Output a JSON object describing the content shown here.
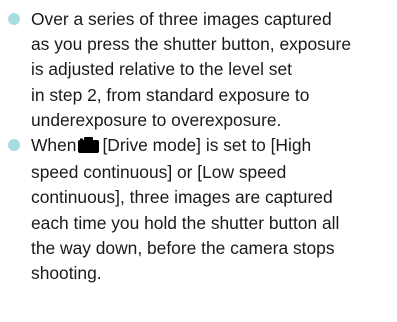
{
  "bullets": [
    {
      "lines": [
        "Over a series of three images captured",
        "as you press the shutter button, exposure",
        "is adjusted relative to the level set",
        "in step 2, from standard exposure to",
        "underexposure to overexposure."
      ]
    },
    {
      "lines": [
        "When",
        "[Drive mode] is set to [High",
        "speed continuous] or [Low speed",
        "continuous], three images are captured",
        "each time you hold the shutter button all",
        "the way down, before the camera stops",
        "shooting."
      ],
      "inline_icon": "camera-icon"
    }
  ],
  "colors": {
    "bullet": "#a8dde0",
    "text": "#1a1a1a",
    "icon": "#000000"
  }
}
